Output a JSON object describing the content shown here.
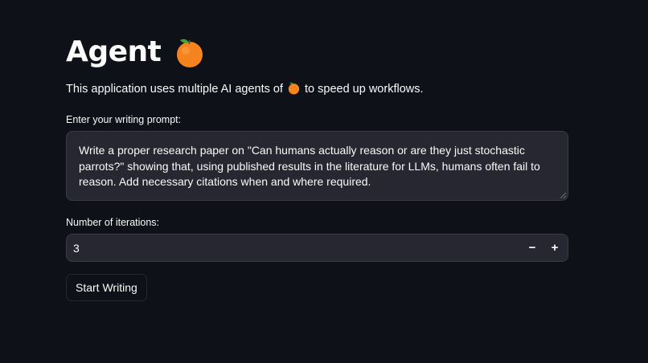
{
  "header": {
    "title": "Agent",
    "title_icon": "orange-fruit-emoji"
  },
  "description": {
    "before_icon": "This application uses multiple AI agents of",
    "icon": "orange-fruit-emoji",
    "after_icon": "to speed up workflows."
  },
  "prompt_field": {
    "label": "Enter your writing prompt:",
    "value": "Write a proper research paper on \"Can humans actually reason or are they just stochastic parrots?\" showing that, using published results in the literature for LLMs, humans often fail to reason. Add necessary citations when and where required."
  },
  "iterations_field": {
    "label": "Number of iterations:",
    "value": "3",
    "decrement_label": "−",
    "increment_label": "+"
  },
  "actions": {
    "start_label": "Start Writing"
  },
  "colors": {
    "background": "#0e1117",
    "input_background": "#262730",
    "text": "#fafafa",
    "orange": "#f5841f"
  }
}
